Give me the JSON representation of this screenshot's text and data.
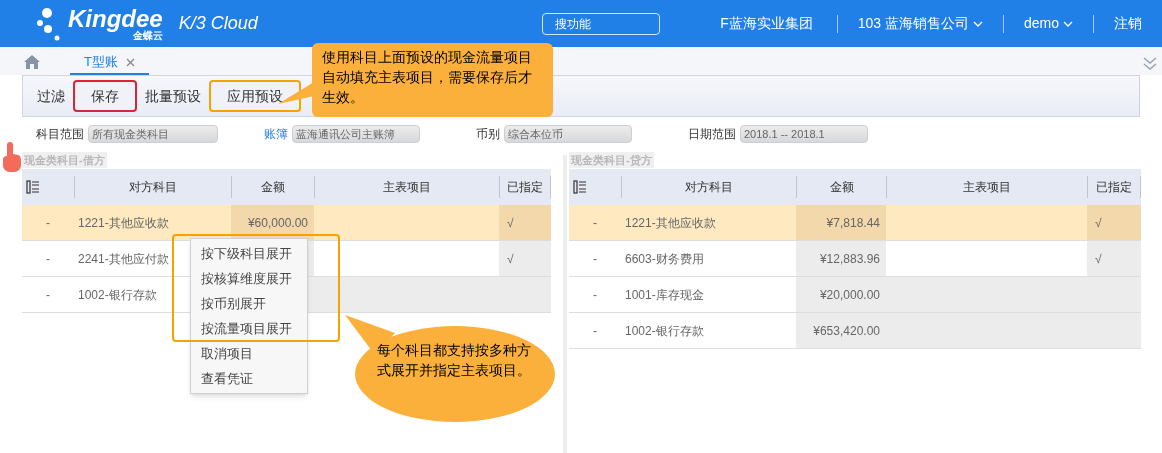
{
  "header": {
    "logo": "Kingdee",
    "logo_sub": "金蝶云",
    "product": "K/3 Cloud",
    "search_button": "搜功能",
    "org": "F蓝海实业集团",
    "company": "103 蓝海销售公司",
    "user": "demo",
    "logout": "注销"
  },
  "tabs": [
    {
      "label": "T型账",
      "selected": true
    }
  ],
  "toolbar": [
    {
      "label": "过滤"
    },
    {
      "label": "保存",
      "color": "#d9243c"
    },
    {
      "label": "批量预设"
    },
    {
      "label": "应用预设",
      "color": "#f5a300"
    }
  ],
  "filters": [
    {
      "label": "科目范围",
      "value": "所有现金类科目",
      "link": false
    },
    {
      "label": "账簿",
      "value": "蓝海通讯公司主账簿",
      "link": true
    },
    {
      "label": "币别",
      "value": "综合本位币",
      "link": false
    },
    {
      "label": "日期范围",
      "value": "2018.1 -- 2018.1",
      "link": false
    }
  ],
  "panels": [
    {
      "title": "现金类科目-借方",
      "columns": [
        "对方科目",
        "金额",
        "主表项目",
        "已指定"
      ],
      "rows": [
        {
          "expander": "-",
          "account": "1221-其他应收款",
          "amount": "¥60,000.00",
          "assigned": "√",
          "selected": true
        },
        {
          "expander": "-",
          "account": "2241-其他应付款",
          "assigned": "√",
          "selected": false
        },
        {
          "expander": "-",
          "account": "1002-银行存款",
          "selected": false
        }
      ]
    },
    {
      "title": "现金类科目-贷方",
      "columns": [
        "对方科目",
        "金额",
        "主表项目",
        "已指定"
      ],
      "rows": [
        {
          "expander": "-",
          "account": "1221-其他应收款",
          "amount": "¥7,818.44",
          "assigned": "√",
          "selected": true
        },
        {
          "expander": "-",
          "account": "6603-财务费用",
          "amount": "¥12,883.96",
          "assigned": "√",
          "selected": false
        },
        {
          "expander": "-",
          "account": "1001-库存现金",
          "amount": "¥20,000.00",
          "selected": false
        },
        {
          "expander": "-",
          "account": "1002-银行存款",
          "amount": "¥653,420.00",
          "selected": false
        }
      ]
    }
  ],
  "context_menu": [
    "按下级科目展开",
    "按核算维度展开",
    "按币别展开",
    "按流量项目展开",
    "取消项目",
    "查看凭证"
  ],
  "callouts": [
    "使用科目上面预设的现金流量项目自动填充主表项目，需要保存后才生效。",
    "每个科目都支持按多种方式展开并指定主表项目。"
  ]
}
